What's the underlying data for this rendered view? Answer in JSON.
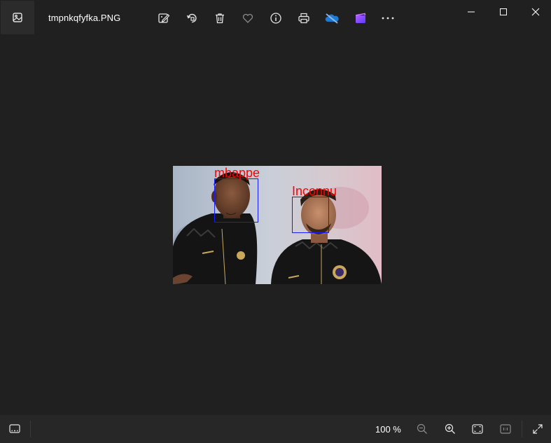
{
  "titlebar": {
    "filename": "tmpnkqfyfka.PNG",
    "app_icon": "photos-app-icon",
    "toolbar": [
      {
        "name": "edit-image-icon"
      },
      {
        "name": "rotate-icon"
      },
      {
        "name": "delete-icon"
      },
      {
        "name": "favorite-icon"
      },
      {
        "name": "info-icon"
      },
      {
        "name": "print-icon"
      },
      {
        "name": "onedrive-icon"
      },
      {
        "name": "clipchamp-icon"
      },
      {
        "name": "more-options-icon"
      }
    ],
    "window_controls": [
      "minimize-icon",
      "maximize-icon",
      "close-icon"
    ]
  },
  "image": {
    "faces": [
      {
        "label": "mbappe"
      },
      {
        "label": "Inconnu"
      }
    ],
    "label_color": "#ff0000",
    "box_color": "#1a1aff"
  },
  "statusbar": {
    "filmstrip_icon": "filmstrip-icon",
    "zoom_value": "100 %",
    "buttons": [
      "zoom-out-icon",
      "zoom-in-icon",
      "fit-to-window-icon",
      "actual-size-icon",
      "fullscreen-icon"
    ]
  },
  "colors": {
    "background": "#202020",
    "statusbar": "#272727",
    "onedrive_blue": "#0f6cbd",
    "clipchamp_purple": "#8a4dff"
  }
}
